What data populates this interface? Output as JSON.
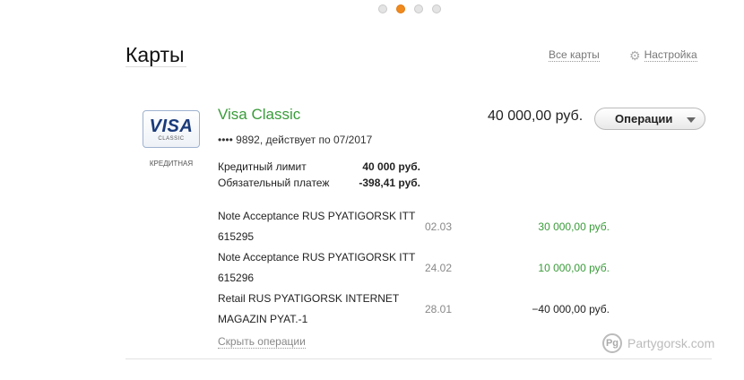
{
  "carousel": {
    "count": 4,
    "active": 1
  },
  "section": {
    "title": "Карты",
    "all_cards": "Все карты",
    "settings": "Настройка"
  },
  "card": {
    "brand": "VISA",
    "brand_sub": "CLASSIC",
    "type": "КРЕДИТНАЯ",
    "name": "Visa Classic",
    "number_info": "•••• 9892, действует по 07/2017",
    "balance": "40 000,00 руб.",
    "ops_button": "Операции",
    "credit_limit_label": "Кредитный лимит",
    "credit_limit_value": "40 000 руб.",
    "payment_label": "Обязательный платеж",
    "payment_value": "-398,41 руб."
  },
  "transactions": [
    {
      "desc": "Note Acceptance RUS PYATIGORSK ITT 615295",
      "date": "02.03",
      "amount": "30 000,00 руб."
    },
    {
      "desc": "Note Acceptance RUS PYATIGORSK ITT 615296",
      "date": "24.02",
      "amount": "10 000,00 руб."
    },
    {
      "desc": "Retail RUS PYATIGORSK INTERNET MAGAZIN PYAT.-1",
      "date": "28.01",
      "amount": "−40 000,00 руб."
    }
  ],
  "hide_ops": "Скрыть операции",
  "watermark": {
    "logo": "Pg",
    "text": "Partygorsk.com"
  },
  "colors": {
    "accent_green": "#3a9b3a",
    "carousel_active": "#f08a1e"
  }
}
